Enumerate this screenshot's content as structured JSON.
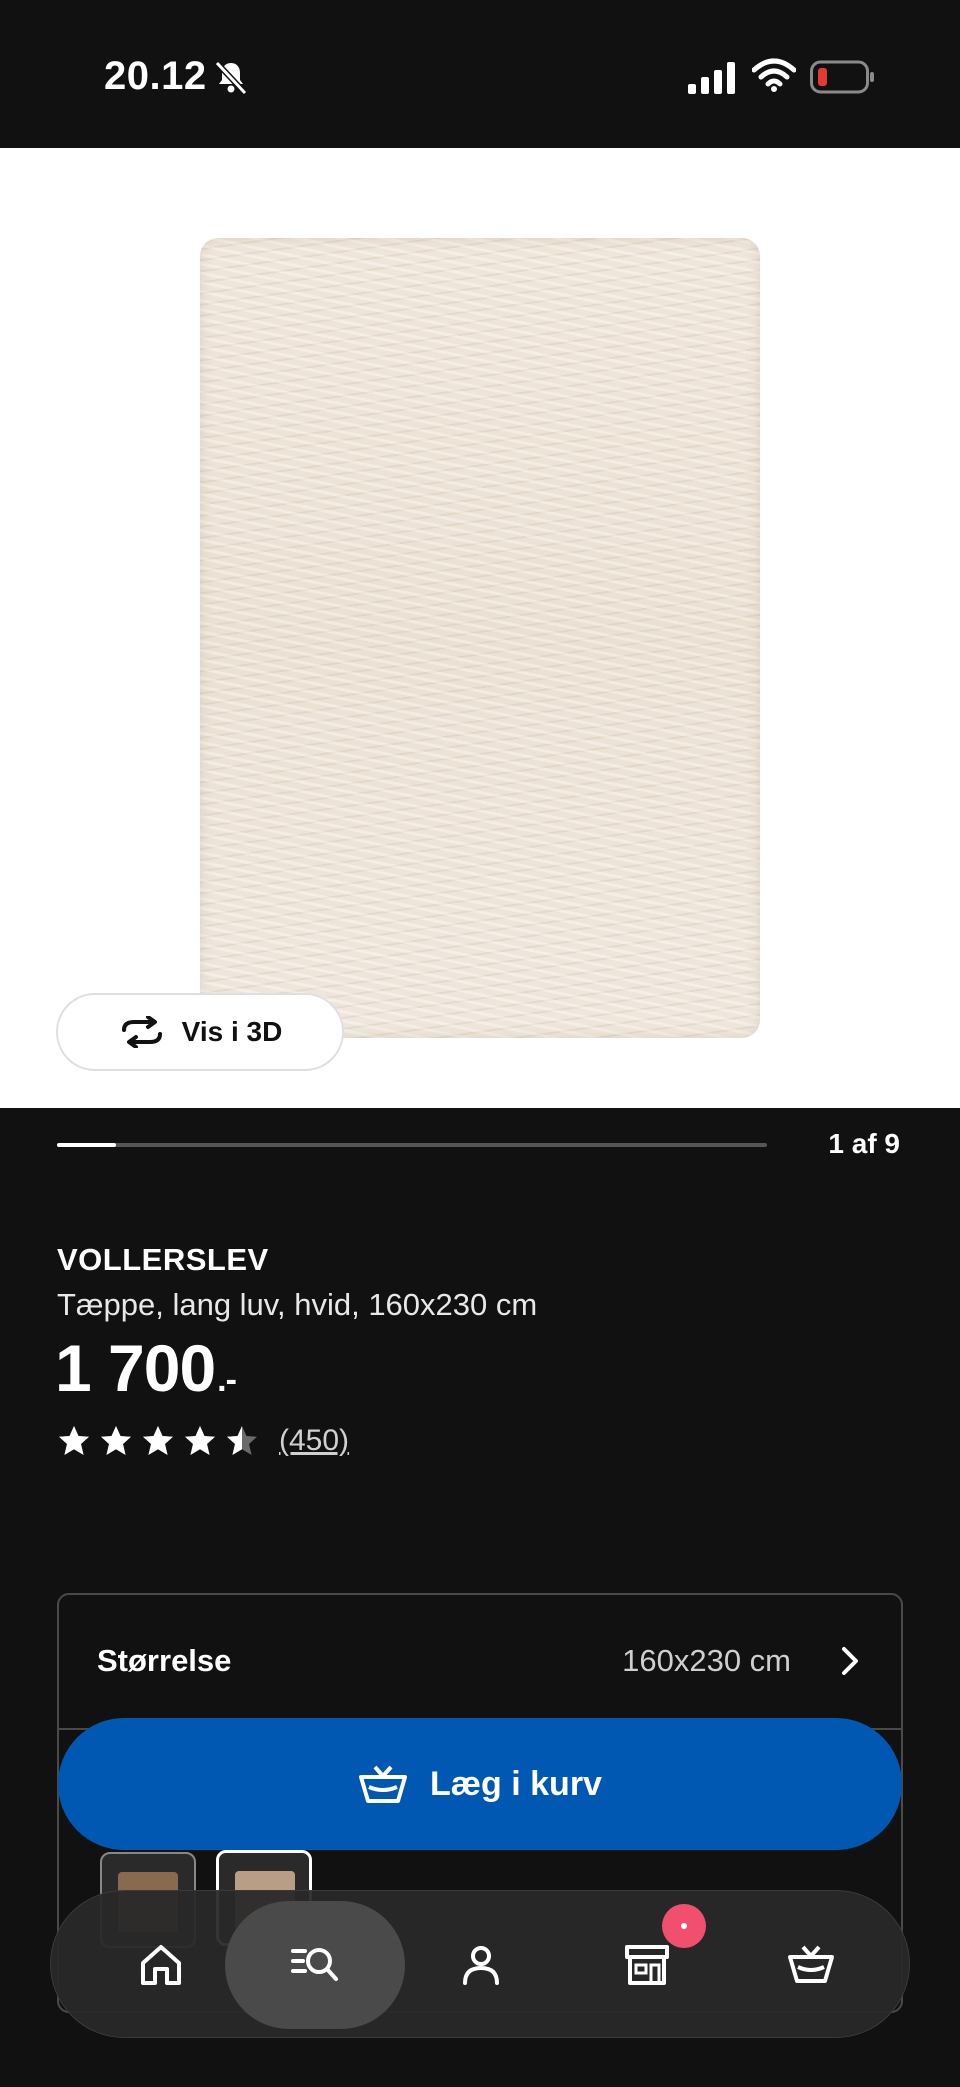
{
  "status_bar": {
    "time": "20.12",
    "icons": [
      "bell-slash-icon",
      "signal-icon",
      "wifi-icon",
      "battery-low-icon"
    ],
    "battery_color": "#e53935"
  },
  "gallery": {
    "view_3d_label": "Vis i 3D",
    "position_label": "1 af 9",
    "current": 1,
    "total": 9,
    "progress_fraction": 0.083
  },
  "product": {
    "name": "VOLLERSLEV",
    "description": "Tæppe, lang luv, hvid, 160x230 cm",
    "price": "1 700",
    "price_suffix": ".-",
    "rating": 4.5,
    "rating_max": 5,
    "review_count": "(450)"
  },
  "size_selector": {
    "label": "Størrelse",
    "value": "160x230 cm"
  },
  "variants": [
    {
      "name": "variant-1",
      "color": "#8a6a4f"
    },
    {
      "name": "variant-2",
      "color": "#b99e86"
    }
  ],
  "actions": {
    "add_to_cart_label": "Læg i kurv",
    "accent_color": "#0058b3"
  },
  "bottom_nav": {
    "items": [
      "home-icon",
      "search-icon",
      "profile-icon",
      "store-icon",
      "cart-icon"
    ],
    "active": "search-icon",
    "badge_color": "#f0506e"
  }
}
